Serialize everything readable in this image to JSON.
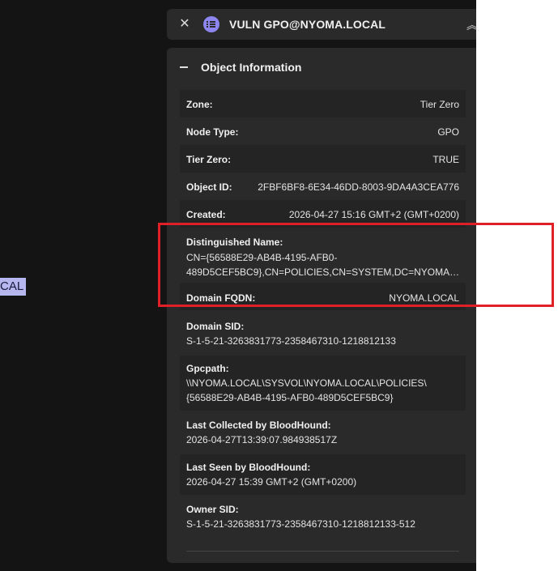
{
  "graph": {
    "node_label": "CAL"
  },
  "header": {
    "title": "VULN GPO@NYOMA.LOCAL"
  },
  "section": {
    "title": "Object Information"
  },
  "fields": {
    "zone": {
      "label": "Zone:",
      "value": "Tier Zero"
    },
    "node_type": {
      "label": "Node Type:",
      "value": "GPO"
    },
    "tier_zero": {
      "label": "Tier Zero:",
      "value": "TRUE"
    },
    "object_id": {
      "label": "Object ID:",
      "value": "2FBF6BF8-6E34-46DD-8003-9DA4A3CEA776"
    },
    "created": {
      "label": "Created:",
      "value": "2026-04-27 15:16 GMT+2 (GMT+0200)"
    },
    "distinguished_name": {
      "label": "Distinguished Name:",
      "line1": "CN={56588E29-AB4B-4195-AFB0-",
      "line2": "489D5CEF5BC9},CN=POLICIES,CN=SYSTEM,DC=NYOMA,DC..."
    },
    "domain_fqdn": {
      "label": "Domain FQDN:",
      "value": "NYOMA.LOCAL"
    },
    "domain_sid": {
      "label": "Domain SID:",
      "value": "S-1-5-21-3263831773-2358467310-1218812133"
    },
    "gpcpath": {
      "label": "Gpcpath:",
      "line1": "\\\\NYOMA.LOCAL\\SYSVOL\\NYOMA.LOCAL\\POLICIES\\",
      "line2": "{56588E29-AB4B-4195-AFB0-489D5CEF5BC9}"
    },
    "last_collected": {
      "label": "Last Collected by BloodHound:",
      "value": "2026-04-27T13:39:07.984938517Z"
    },
    "last_seen": {
      "label": "Last Seen by BloodHound:",
      "value": "2026-04-27 15:39 GMT+2 (GMT+0200)"
    },
    "owner_sid": {
      "label": "Owner SID:",
      "value": "S-1-5-21-3263831773-2358467310-1218812133-512"
    }
  },
  "colors": {
    "highlight": "#e01f26",
    "gpo_icon": "#8e86f0"
  }
}
